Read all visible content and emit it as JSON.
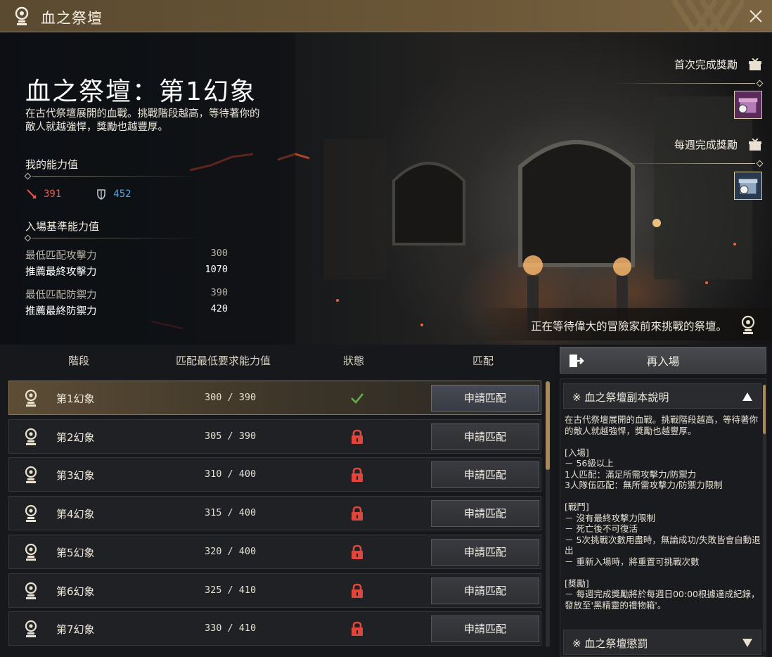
{
  "window": {
    "title": "血之祭壇",
    "close_icon": "close-icon",
    "logo_icon": "altar-icon"
  },
  "hero": {
    "stage_title": "血之祭壇：第1幻象",
    "description": "在古代祭壇展開的血戰。挑戰階段越高，等待著你的敵人就越強悍，獎勵也越豐厚。",
    "my_stats": {
      "label": "我的能力值",
      "attack": "391",
      "defense": "452",
      "attack_color": "#e55b4f",
      "defense_color": "#4ba7e6"
    },
    "entry_requirements": {
      "label": "入場基準能力值",
      "rows": [
        {
          "label": "最低匹配攻擊力",
          "value": "300"
        },
        {
          "label": "推薦最終攻擊力",
          "value": "1070"
        },
        {
          "label": "最低匹配防禦力",
          "value": "390"
        },
        {
          "label": "推薦最終防禦力",
          "value": "420"
        }
      ]
    },
    "rewards": {
      "first_clear_label": "首次完成獎勵",
      "weekly_clear_label": "每週完成獎勵"
    },
    "waiting_text": "正在等待偉大的冒險家前來挑戰的祭壇。"
  },
  "stage_list": {
    "headers": {
      "stage": "階段",
      "requirement": "匹配最低要求能力值",
      "status": "狀態",
      "match": "匹配"
    },
    "rows": [
      {
        "name": "第1幻象",
        "req": "300 / 390",
        "status": "cleared",
        "button": "申請匹配"
      },
      {
        "name": "第2幻象",
        "req": "305 / 390",
        "status": "locked",
        "button": "申請匹配"
      },
      {
        "name": "第3幻象",
        "req": "310 / 400",
        "status": "locked",
        "button": "申請匹配"
      },
      {
        "name": "第4幻象",
        "req": "315 / 400",
        "status": "locked",
        "button": "申請匹配"
      },
      {
        "name": "第5幻象",
        "req": "320 / 400",
        "status": "locked",
        "button": "申請匹配"
      },
      {
        "name": "第6幻象",
        "req": "325 / 410",
        "status": "locked",
        "button": "申請匹配"
      },
      {
        "name": "第7幻象",
        "req": "330 / 410",
        "status": "locked",
        "button": "申請匹配"
      }
    ],
    "accent_color": "#a88a5a",
    "lock_color": "#e0463c",
    "check_color": "#5fb04a"
  },
  "right_panel": {
    "reenter_label": "再入場",
    "info_header": "※ 血之祭壇副本說明",
    "info_text": "在古代祭壇展開的血戰。挑戰階段越高，等待著你的敵人就越強悍，獎勵也越豐厚。\n\n[入場]\n－ 56級以上\n1人匹配：滿足所需攻擊力/防禦力\n3人隊伍匹配：無所需攻擊力/防禦力限制\n\n[戰鬥]\n－ 沒有最終攻擊力限制\n－ 死亡後不可復活\n－ 5次挑戰次數用盡時，無論成功/失敗皆會自動退出\n－ 重新入場時，將重置可挑戰次數\n\n[獎勵]\n－ 每週完成獎勵將於每週日00:00根據達成紀錄，發放至'黑精靈的禮物箱'。",
    "penalty_header": "※ 血之祭壇懲罰"
  }
}
